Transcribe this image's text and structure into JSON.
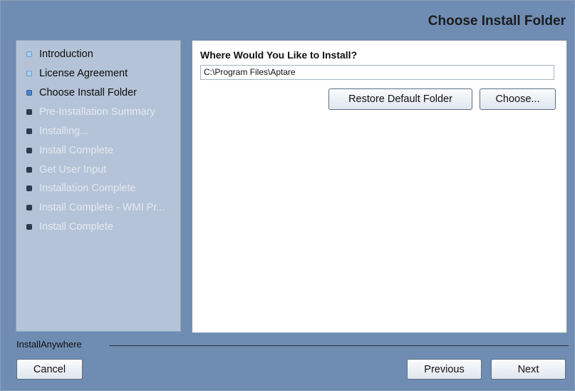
{
  "header": {
    "title": "Choose Install Folder"
  },
  "steps": [
    {
      "label": "Introduction",
      "state": "done"
    },
    {
      "label": "License Agreement",
      "state": "done"
    },
    {
      "label": "Choose Install Folder",
      "state": "current"
    },
    {
      "label": "Pre-Installation Summary",
      "state": "pending"
    },
    {
      "label": "Installing...",
      "state": "pending"
    },
    {
      "label": "Install Complete",
      "state": "pending"
    },
    {
      "label": "Get User Input",
      "state": "pending"
    },
    {
      "label": "Installation Complete",
      "state": "pending"
    },
    {
      "label": "Install Complete - WMI Pr...",
      "state": "pending"
    },
    {
      "label": "Install Complete",
      "state": "pending"
    }
  ],
  "main": {
    "question": "Where Would You Like to Install?",
    "install_path": "C:\\Program Files\\Aptare",
    "restore_button": "Restore Default Folder",
    "choose_button": "Choose..."
  },
  "footer": {
    "brand": "InstallAnywhere",
    "cancel_button": "Cancel",
    "previous_button": "Previous",
    "next_button": "Next"
  },
  "colors": {
    "window_background": "#6f8db3",
    "steps_panel": "#b4c3d7",
    "current_step_dot": "#4f82c6",
    "done_step_dot": "#a8cef0",
    "pending_step_dot": "#2d3a4c"
  }
}
